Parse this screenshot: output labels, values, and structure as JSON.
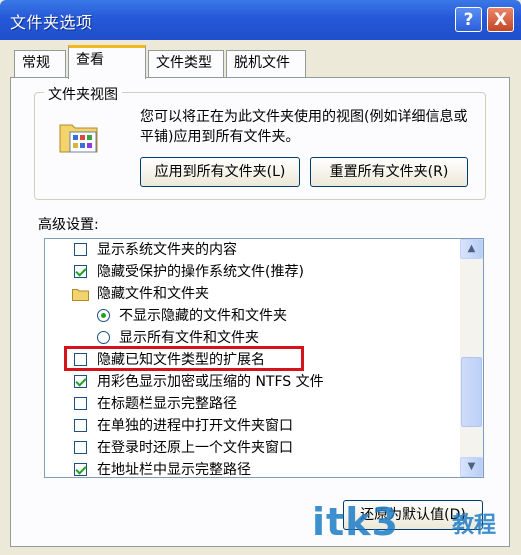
{
  "window": {
    "title": "文件夹选项",
    "help": "?",
    "close": "X"
  },
  "tabs": [
    {
      "label": "常规",
      "active": false
    },
    {
      "label": "查看",
      "active": true
    },
    {
      "label": "文件类型",
      "active": false
    },
    {
      "label": "脱机文件",
      "active": false
    }
  ],
  "folder_view": {
    "legend": "文件夹视图",
    "description": "您可以将正在为此文件夹使用的视图(例如详细信息或平铺)应用到所有文件夹。",
    "apply_button": "应用到所有文件夹(L)",
    "reset_button": "重置所有文件夹(R)"
  },
  "advanced": {
    "label": "高级设置:",
    "items": [
      {
        "type": "checkbox",
        "checked": false,
        "label": "显示系统文件夹的内容"
      },
      {
        "type": "checkbox",
        "checked": true,
        "label": "隐藏受保护的操作系统文件(推荐)"
      },
      {
        "type": "folder",
        "label": "隐藏文件和文件夹"
      },
      {
        "type": "radio",
        "checked": true,
        "label": "不显示隐藏的文件和文件夹"
      },
      {
        "type": "radio",
        "checked": false,
        "label": "显示所有文件和文件夹"
      },
      {
        "type": "checkbox",
        "checked": false,
        "label": "隐藏已知文件类型的扩展名"
      },
      {
        "type": "checkbox",
        "checked": true,
        "label": "用彩色显示加密或压缩的 NTFS 文件"
      },
      {
        "type": "checkbox",
        "checked": false,
        "label": "在标题栏显示完整路径"
      },
      {
        "type": "checkbox",
        "checked": false,
        "label": "在单独的进程中打开文件夹窗口"
      },
      {
        "type": "checkbox",
        "checked": false,
        "label": "在登录时还原上一个文件夹窗口"
      },
      {
        "type": "checkbox",
        "checked": true,
        "label": "在地址栏中显示完整路径"
      }
    ],
    "restore_button": "还原为默认值(D)"
  },
  "watermark": {
    "text": "itk3",
    "suffix": "教程"
  },
  "colors": {
    "titlebar": "#2558d9",
    "highlight": "#d4141a",
    "check": "#21a121"
  }
}
